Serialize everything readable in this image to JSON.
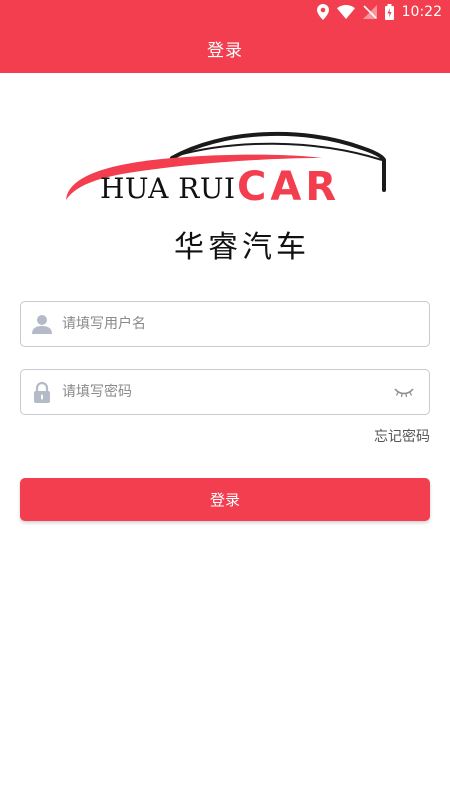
{
  "status_bar": {
    "time": "10:22",
    "icons": [
      "location-icon",
      "wifi-icon",
      "signal-off-icon",
      "battery-icon"
    ]
  },
  "header": {
    "title": "登录"
  },
  "logo": {
    "latin_text": "HUA RUI",
    "car_text": "CAR",
    "chinese_text": "华睿汽车"
  },
  "form": {
    "username": {
      "placeholder": "请填写用户名",
      "value": "",
      "icon": "user-icon"
    },
    "password": {
      "placeholder": "请填写密码",
      "value": "",
      "icon": "lock-icon",
      "toggle_icon": "eye-closed-icon"
    },
    "forgot_password": "忘记密码",
    "submit_label": "登录"
  },
  "colors": {
    "accent": "#f23e4e",
    "input_border": "#c9c9cf",
    "icon_gray": "#b4bac7"
  }
}
